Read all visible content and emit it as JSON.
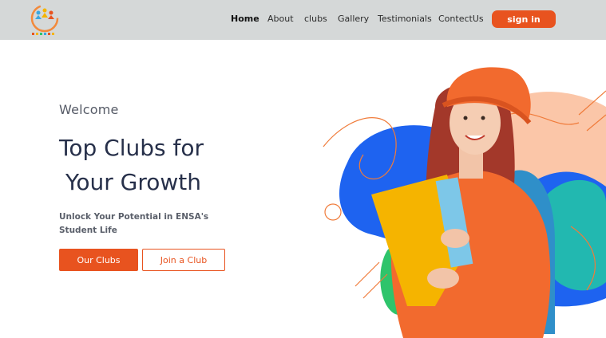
{
  "brand": {
    "logo_alt": "Clubs logo"
  },
  "nav": {
    "items": [
      {
        "label": "Home",
        "active": true
      },
      {
        "label": "About",
        "active": false
      },
      {
        "label": "clubs",
        "active": false
      },
      {
        "label": "Gallery",
        "active": false
      },
      {
        "label": "Testimonials",
        "active": false
      },
      {
        "label": "ContectUs",
        "active": false
      }
    ],
    "signin_label": "sign in"
  },
  "hero": {
    "welcome": "Welcome",
    "headline_line1": "Top Clubs for",
    "headline_line2": "Your Growth",
    "subtitle": "Unlock Your Potential in ENSA's Student Life",
    "primary_button": "Our Clubs",
    "secondary_button": "Join a Club",
    "image_alt": "Student girl in orange beanie holding folders"
  },
  "colors": {
    "accent": "#e8531f",
    "nav_bg": "#d5d8d8",
    "heading": "#27304a",
    "blob_blue": "#1e63f0",
    "blob_peach": "#fbc6a8",
    "blob_green": "#2ec46b"
  }
}
